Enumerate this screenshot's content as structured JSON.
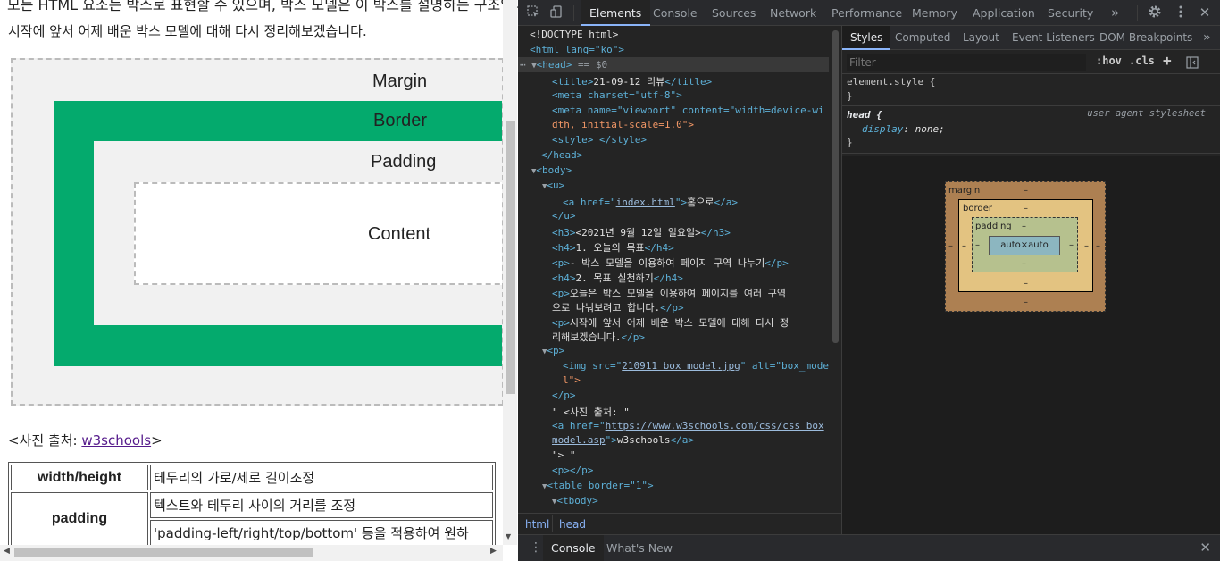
{
  "page": {
    "top_clipped_text": "모든 HTML 요소는 박스로 표현할 수 있으며, 박스 모델은 이 박스를 설명하는 구조입니다.",
    "intro": "시작에 앞서 어제 배운 박스 모델에 대해 다시 정리해보겠습니다.",
    "box_model": {
      "margin_label": "Margin",
      "border_label": "Border",
      "padding_label": "Padding",
      "content_label": "Content"
    },
    "source_prefix": "<사진 출처: ",
    "source_link": "w3schools",
    "source_suffix": ">",
    "table": {
      "row1_head": "width/height",
      "row1_cell": "테두리의 가로/세로 길이조정",
      "row2_head": "padding",
      "row2_cell1": "텍스트와 테두리 사이의 거리를 조정",
      "row2_cell2": "'padding-left/right/top/bottom' 등을 적용하여 원하"
    }
  },
  "devtools": {
    "toolbar": {
      "tabs": [
        "Elements",
        "Console",
        "Sources",
        "Network",
        "Performance",
        "Memory",
        "Application",
        "Security"
      ],
      "more": "»",
      "inspect_icon": "inspect-icon",
      "device_icon": "device-toggle-icon",
      "settings_icon": "gear-icon",
      "menu_icon": "kebab-menu-icon"
    },
    "elements": {
      "doctype": "<!DOCTYPE html>",
      "html_open": "<html lang=\"ko\">",
      "lines": {
        "head": "<head>",
        "head_sel": "== $0",
        "title_tag_open": "<title>",
        "title_text": "21-09-12 리뷰",
        "title_tag_close": "</title>",
        "meta_charset": "<meta charset=\"utf-8\">",
        "meta_viewport_a": "<meta name=\"viewport\" content=\"width=device-wi",
        "meta_viewport_b": "dth, initial-scale=1.0\">",
        "style": "<style> </style>",
        "head_close": "</head>",
        "body_open": "<body>",
        "u_open": "<u>",
        "a_open_pre": "<a href=\"",
        "a_href": "index.html",
        "a_open_post": "\">",
        "a_text": "홈으로",
        "a_close": "</a>",
        "u_close": "</u>",
        "h3_open": "<h3>",
        "h3_text": "<2021년 9월 12일 일요일>",
        "h3_close": "</h3>",
        "h4_1_text": "1. 오늘의 목표",
        "p_1_text": "- 박스 모델을 이용하여 페이지 구역 나누기",
        "h4_2_text": "2. 목표 실천하기",
        "p_2a_text": "오늘은 박스 모델을 이용하여 페이지를 여러 구역",
        "p_2b_text": "으로 나눠보려고 합니다.",
        "p_3a_text": "시작에 앞서 어제 배운 박스 모델에 대해 다시 정",
        "p_3b_text": "리해보겠습니다.",
        "p_open": "<p>",
        "img_pre": "<img src=\"",
        "img_src": "210911 box model.jpg",
        "img_mid": "\" alt=\"box_mode",
        "img_cont": "l\">",
        "p_close": "</p>",
        "photo_src_text": "\" <사진 출처: \"",
        "a2_pre": "<a href=\"",
        "a2_href_a": "https://www.w3schools.com/css/css_box",
        "a2_href_b": "model.asp",
        "a2_post": "\">",
        "a2_text": "w3schools",
        "a2_close": "</a>",
        "text_close": "\"> \"",
        "empty_p": "<p></p>",
        "table_open": "<table border=\"1\">",
        "tbody_open": "<tbody>"
      },
      "breadcrumb": [
        "html",
        "head"
      ]
    },
    "styles": {
      "tabs": [
        "Styles",
        "Computed",
        "Layout",
        "Event Listeners",
        "DOM Breakpoints"
      ],
      "more": "»",
      "filter_placeholder": "Filter",
      "hov": ":hov",
      "cls": ".cls",
      "add": "+",
      "element_style_selector": "element.style {",
      "brace_close": "}",
      "head_selector": "head {",
      "user_agent_label": "user agent stylesheet",
      "display_prop": "display",
      "display_val": "none;",
      "box": {
        "margin": "margin",
        "border": "border",
        "padding": "padding",
        "content": "auto×auto",
        "dash": "–"
      }
    },
    "drawer": {
      "tabs": [
        "Console",
        "What's New"
      ],
      "close": "✕"
    }
  }
}
